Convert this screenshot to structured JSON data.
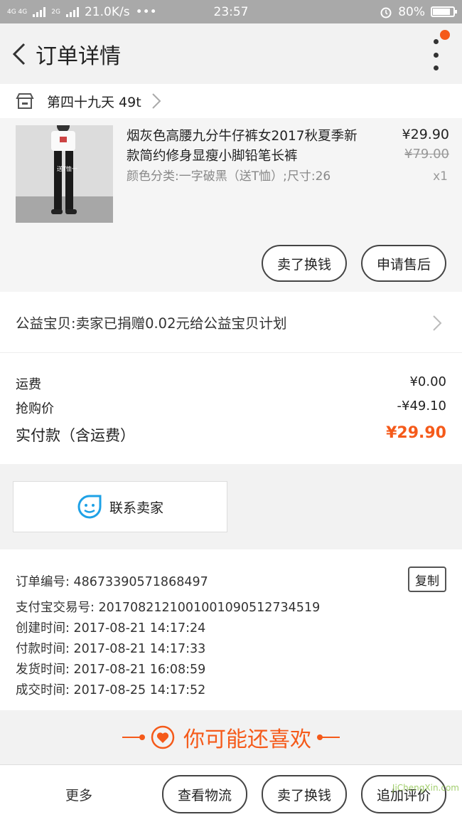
{
  "status_bar": {
    "network": "4G 4G",
    "network2": "2G",
    "speed": "21.0K/s",
    "dots": "•••",
    "time": "23:57",
    "battery": "80%"
  },
  "header": {
    "title": "订单详情"
  },
  "shop": {
    "name": "第四十九天 49t"
  },
  "product": {
    "title": "烟灰色高腰九分牛仔裤女2017秋夏季新款简约修身显瘦小脚铅笔长裤",
    "spec": "颜色分类:一字破黑（送T恤）;尺寸:26",
    "price": "¥29.90",
    "original_price": "¥79.00",
    "quantity": "x1",
    "image_tag": "送T恤一"
  },
  "actions": {
    "sell_label": "卖了换钱",
    "after_sale_label": "申请售后"
  },
  "charity": {
    "text": "公益宝贝:卖家已捐赠0.02元给公益宝贝计划"
  },
  "fees": {
    "shipping_label": "运费",
    "shipping_value": "¥0.00",
    "discount_label": "抢购价",
    "discount_value": "-¥49.10",
    "total_label": "实付款（含运费）",
    "total_value": "¥29.90"
  },
  "contact": {
    "label": "联系卖家"
  },
  "order_info": {
    "order_no": "订单编号: 4867339057186849​7",
    "alipay_no": "支付宝交易号: 2017082121001001090512734519",
    "created": "创建时间: 2017-08-21 14:17:24",
    "paid": "付款时间: 2017-08-21 14:17:33",
    "shipped": "发货时间: 2017-08-21 16:08:59",
    "completed": "成交时间: 2017-08-25 14:17:52",
    "copy_label": "复制"
  },
  "recommend": {
    "text": "你可能还喜欢"
  },
  "bottom_bar": {
    "more_label": "更多",
    "logistics_label": "查看物流",
    "sell_label": "卖了换钱",
    "review_label": "追加评价"
  },
  "watermark": "JiChengXin.com",
  "colors": {
    "accent": "#f55a1a",
    "contact_icon": "#1ea1e6"
  }
}
